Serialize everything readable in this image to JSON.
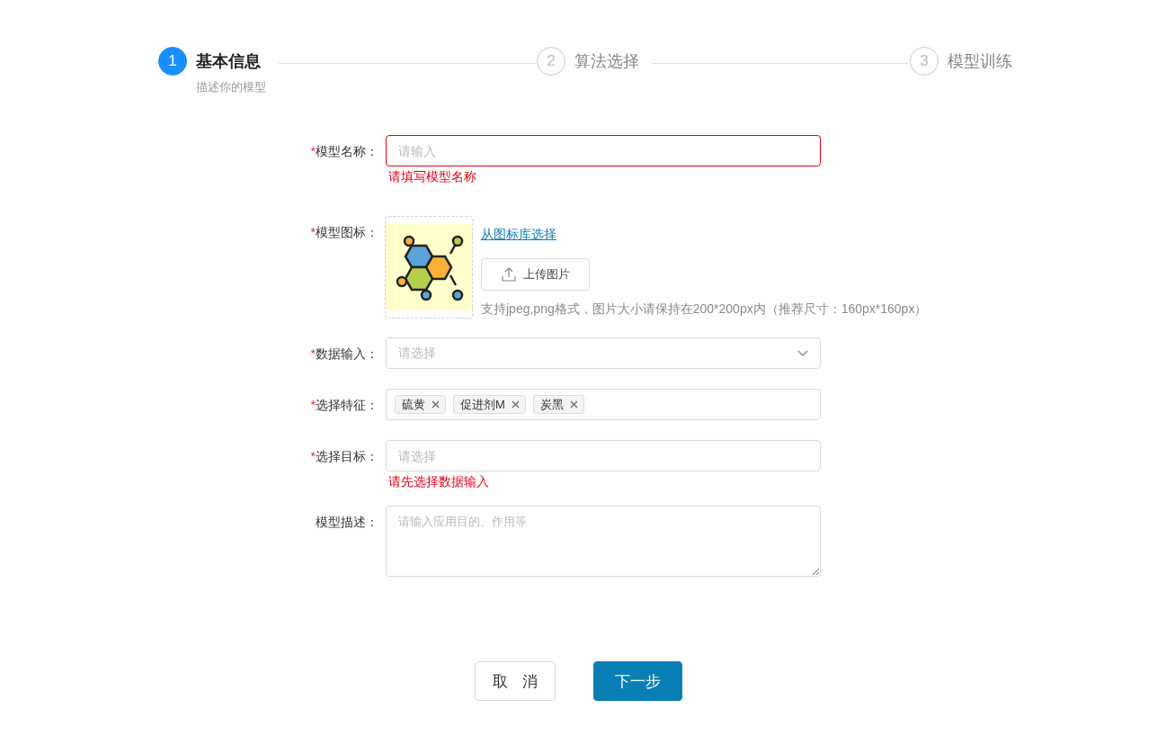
{
  "steps": [
    {
      "number": "1",
      "title": "基本信息",
      "description": "描述你的模型",
      "active": true
    },
    {
      "number": "2",
      "title": "算法选择",
      "active": false
    },
    {
      "number": "3",
      "title": "模型训练",
      "active": false
    }
  ],
  "form": {
    "fields": [
      {
        "kind": "input",
        "required_mark": "*",
        "label": "模型名称：",
        "placeholder": "请输入",
        "invalid": true,
        "error": "请填写模型名称"
      },
      {
        "kind": "upload",
        "required_mark": "*",
        "label": "模型图标：",
        "link": "从图标库选择",
        "button": "上传图片",
        "hint": "支持jpeg,png格式，图片大小请保持在200*200px内（推荐尺寸：160px*160px）"
      },
      {
        "kind": "select",
        "required_mark": "*",
        "label": "数据输入：",
        "placeholder": "请选择",
        "invalid": false
      },
      {
        "kind": "tags",
        "required_mark": "*",
        "label": "选择特征：",
        "tags": [
          "硫黄",
          "促进剂M",
          "炭黑"
        ],
        "invalid": false
      },
      {
        "kind": "input",
        "required_mark": "*",
        "label": "选择目标：",
        "placeholder": "请选择",
        "invalid": false,
        "error": "请先选择数据输入"
      },
      {
        "kind": "textarea",
        "label": "模型描述：",
        "placeholder": "请输入应用目的、作用等",
        "invalid": false
      }
    ]
  },
  "buttons": [
    {
      "label": "取 消",
      "kind": "secondary"
    },
    {
      "label": "下一步",
      "kind": "primary"
    }
  ]
}
